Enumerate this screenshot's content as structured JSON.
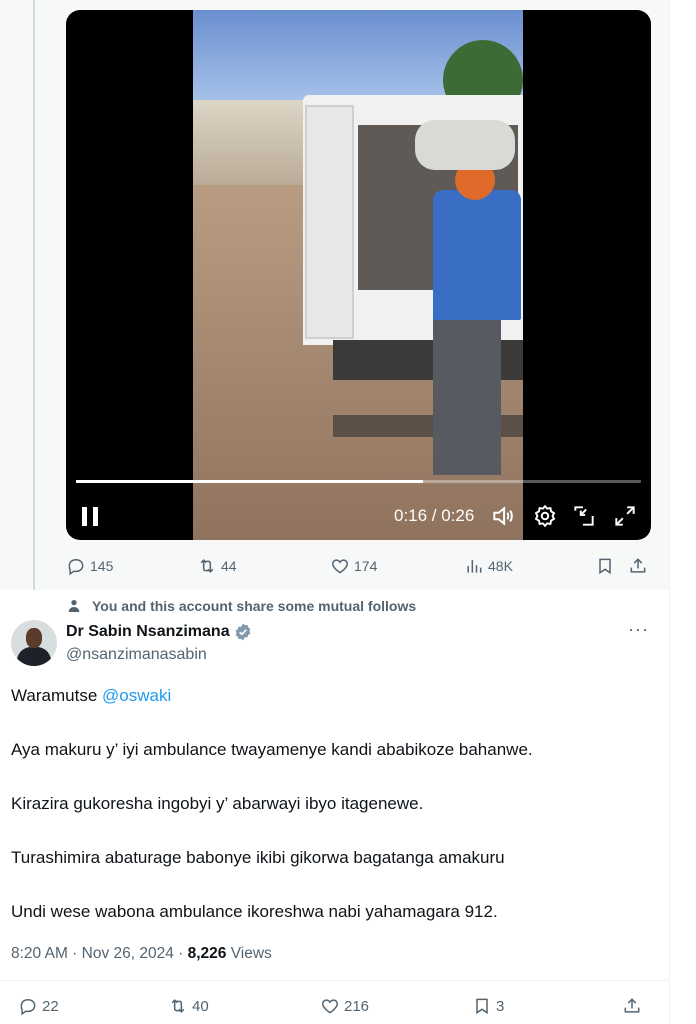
{
  "parent": {
    "video": {
      "timecode": "0:16 / 0:26",
      "progress": 0.615
    },
    "actions": {
      "replies": "145",
      "reposts": "44",
      "likes": "174",
      "views": "48K"
    }
  },
  "tweet": {
    "social_context": "You and this account share some mutual follows",
    "author_name": "Dr Sabin Nsanzimana",
    "handle": "@nsanzimanasabin",
    "greeting": "Waramutse ",
    "mention": "@oswaki",
    "paragraphs": [
      "Aya makuru y’ iyi ambulance twayamenye kandi ababikoze bahanwe.",
      "Kirazira gukoresha ingobyi y’ abarwayi ibyo itagenewe.",
      "Turashimira abaturage babonye ikibi gikorwa bagatanga amakuru",
      "Undi wese wabona ambulance ikoreshwa nabi yahamagara 912."
    ],
    "time": "8:20 AM · Nov 26, 2024 · ",
    "views_count": "8,226",
    "views_label": " Views",
    "actions": {
      "replies": "22",
      "reposts": "40",
      "likes": "216",
      "bookmarks": "3"
    }
  },
  "colors": {
    "accent": "#1d9bf0",
    "muted": "#536471",
    "text": "#0f1419"
  }
}
